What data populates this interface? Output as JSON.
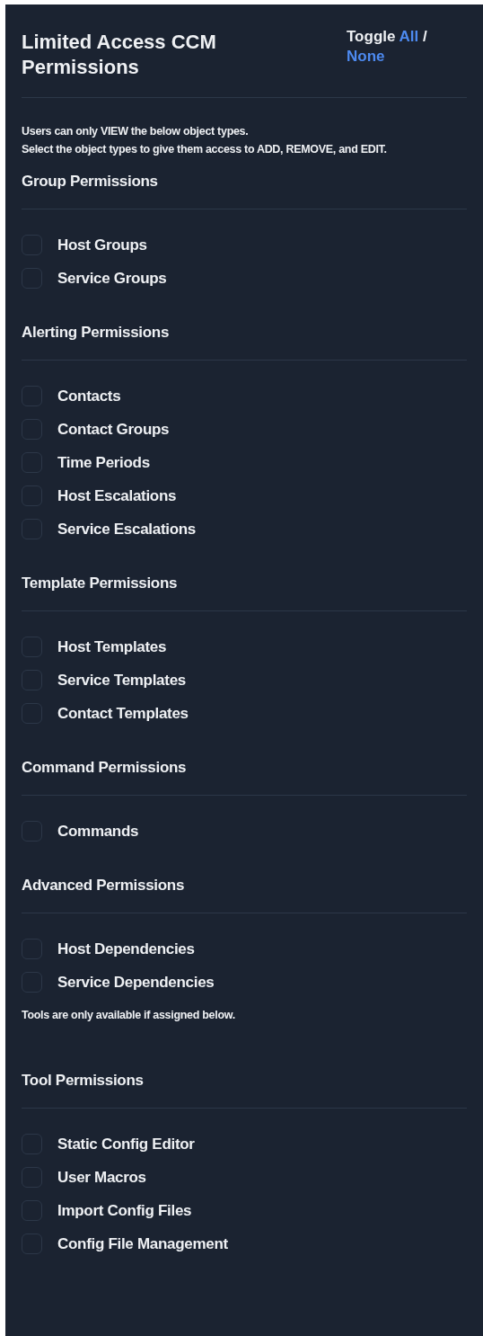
{
  "panel": {
    "title": "Limited Access CCM Permissions",
    "toggle": {
      "label": "Toggle",
      "all": "All",
      "separator": "/",
      "none": "None"
    }
  },
  "intro": [
    "Users can only VIEW the below object types.",
    "Select the object types to give them access to ADD, REMOVE, and EDIT."
  ],
  "sections": [
    {
      "heading": "Group Permissions",
      "items": [
        {
          "label": "Host Groups",
          "checked": false
        },
        {
          "label": "Service Groups",
          "checked": false
        }
      ]
    },
    {
      "heading": "Alerting Permissions",
      "items": [
        {
          "label": "Contacts",
          "checked": false
        },
        {
          "label": "Contact Groups",
          "checked": false
        },
        {
          "label": "Time Periods",
          "checked": false
        },
        {
          "label": "Host Escalations",
          "checked": false
        },
        {
          "label": "Service Escalations",
          "checked": false
        }
      ]
    },
    {
      "heading": "Template Permissions",
      "items": [
        {
          "label": "Host Templates",
          "checked": false
        },
        {
          "label": "Service Templates",
          "checked": false
        },
        {
          "label": "Contact Templates",
          "checked": false
        }
      ]
    },
    {
      "heading": "Command Permissions",
      "items": [
        {
          "label": "Commands",
          "checked": false
        }
      ]
    },
    {
      "heading": "Advanced Permissions",
      "items": [
        {
          "label": "Host Dependencies",
          "checked": false
        },
        {
          "label": "Service Dependencies",
          "checked": false
        }
      ],
      "note": "Tools are only available if assigned below."
    },
    {
      "heading": "Tool Permissions",
      "items": [
        {
          "label": "Static Config Editor",
          "checked": false
        },
        {
          "label": "User Macros",
          "checked": false
        },
        {
          "label": "Import Config Files",
          "checked": false
        },
        {
          "label": "Config File Management",
          "checked": false
        }
      ]
    }
  ]
}
